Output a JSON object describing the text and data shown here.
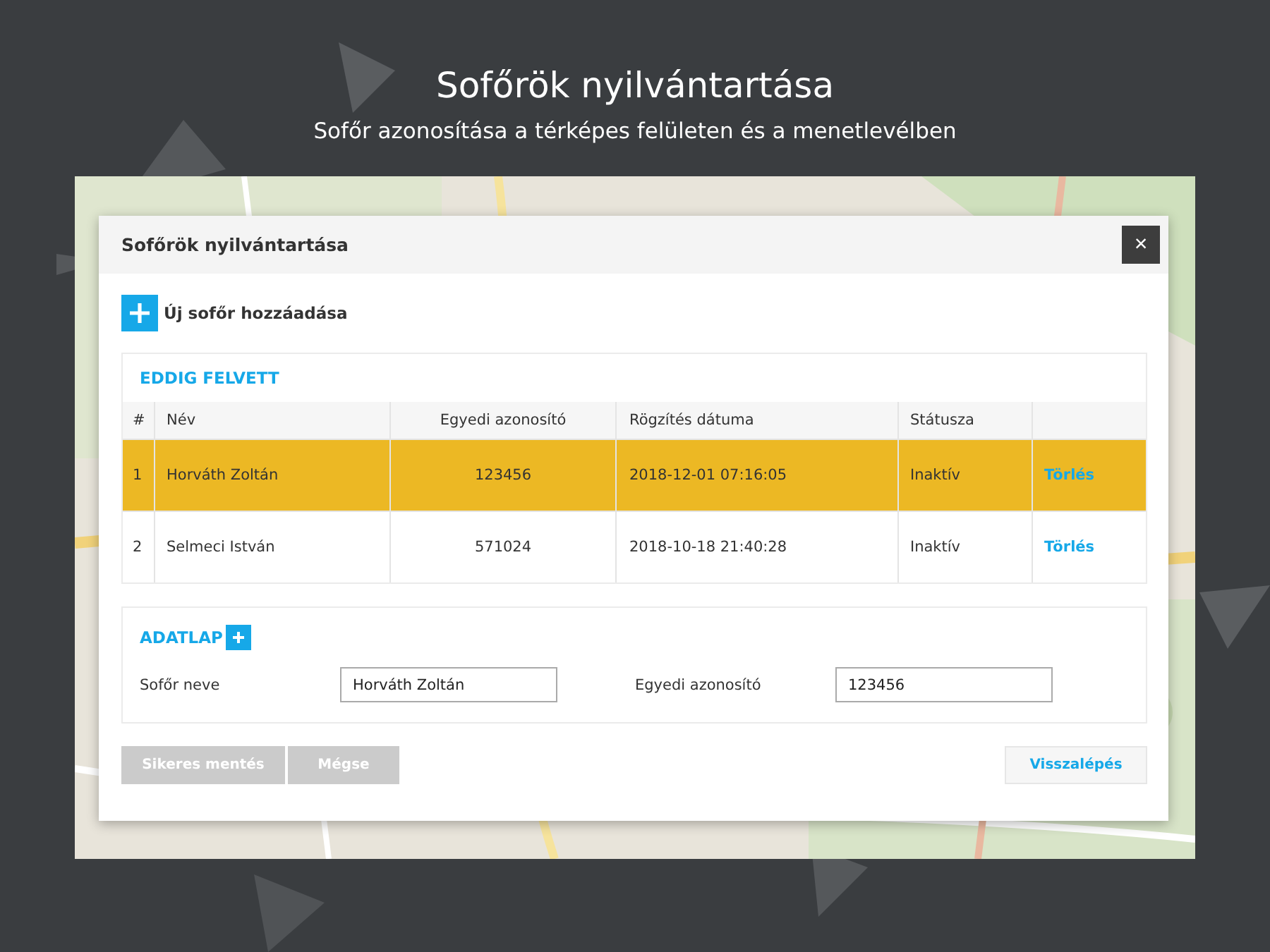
{
  "page": {
    "title": "Sofőrök nyilvántartása",
    "subtitle": "Sofőr azonosítása a térképes felületen és a menetlevélben"
  },
  "dialog": {
    "title": "Sofőrök nyilvántartása",
    "close": "×",
    "add_label": "Új sofőr hozzáadása",
    "list": {
      "heading": "EDDIG FELVETT",
      "columns": [
        "#",
        "Név",
        "Egyedi azonosító",
        "Rögzítés dátuma",
        "Státusza"
      ],
      "rows": [
        {
          "index": "1",
          "name": "Horváth Zoltán",
          "id": "123456",
          "date": "2018-12-01 07:16:05",
          "status": "Inaktív",
          "action": "Törlés",
          "selected": true
        },
        {
          "index": "2",
          "name": "Selmeci István",
          "id": "571024",
          "date": "2018-10-18 21:40:28",
          "status": "Inaktív",
          "action": "Törlés",
          "selected": false
        }
      ]
    },
    "form": {
      "heading": "ADATLAP",
      "fields": [
        {
          "label": "Sofőr neve",
          "value": "Horváth Zoltán"
        },
        {
          "label": "Egyedi azonosító",
          "value": "123456"
        }
      ]
    },
    "buttons": [
      {
        "label": "Sikeres mentés",
        "disabled": true
      },
      {
        "label": "Mégse",
        "disabled": true
      }
    ],
    "back_button": {
      "label": "Visszalépés",
      "disabled": false
    }
  }
}
